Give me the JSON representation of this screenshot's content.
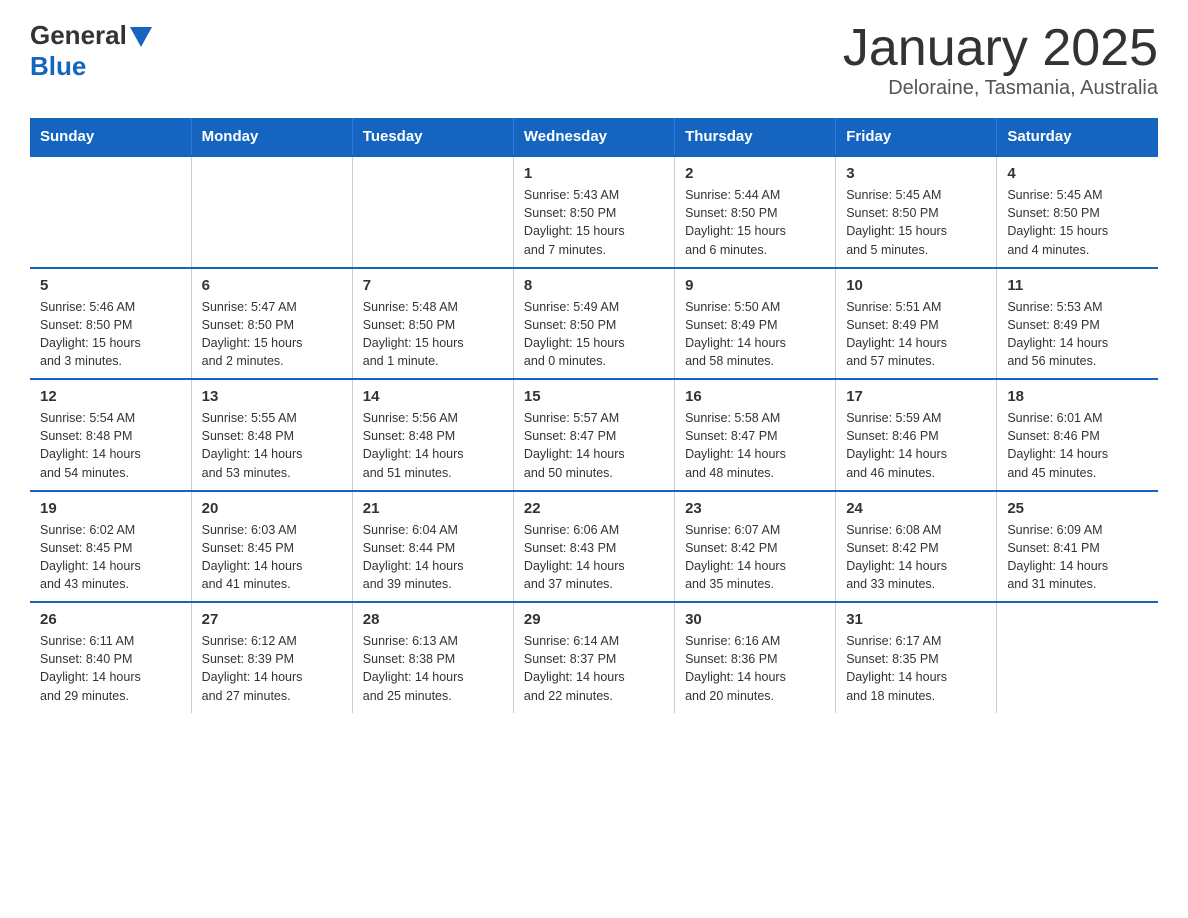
{
  "header": {
    "logo_general": "General",
    "logo_blue": "Blue",
    "title": "January 2025",
    "subtitle": "Deloraine, Tasmania, Australia"
  },
  "calendar": {
    "days_of_week": [
      "Sunday",
      "Monday",
      "Tuesday",
      "Wednesday",
      "Thursday",
      "Friday",
      "Saturday"
    ],
    "weeks": [
      [
        {
          "day": "",
          "info": ""
        },
        {
          "day": "",
          "info": ""
        },
        {
          "day": "",
          "info": ""
        },
        {
          "day": "1",
          "info": "Sunrise: 5:43 AM\nSunset: 8:50 PM\nDaylight: 15 hours\nand 7 minutes."
        },
        {
          "day": "2",
          "info": "Sunrise: 5:44 AM\nSunset: 8:50 PM\nDaylight: 15 hours\nand 6 minutes."
        },
        {
          "day": "3",
          "info": "Sunrise: 5:45 AM\nSunset: 8:50 PM\nDaylight: 15 hours\nand 5 minutes."
        },
        {
          "day": "4",
          "info": "Sunrise: 5:45 AM\nSunset: 8:50 PM\nDaylight: 15 hours\nand 4 minutes."
        }
      ],
      [
        {
          "day": "5",
          "info": "Sunrise: 5:46 AM\nSunset: 8:50 PM\nDaylight: 15 hours\nand 3 minutes."
        },
        {
          "day": "6",
          "info": "Sunrise: 5:47 AM\nSunset: 8:50 PM\nDaylight: 15 hours\nand 2 minutes."
        },
        {
          "day": "7",
          "info": "Sunrise: 5:48 AM\nSunset: 8:50 PM\nDaylight: 15 hours\nand 1 minute."
        },
        {
          "day": "8",
          "info": "Sunrise: 5:49 AM\nSunset: 8:50 PM\nDaylight: 15 hours\nand 0 minutes."
        },
        {
          "day": "9",
          "info": "Sunrise: 5:50 AM\nSunset: 8:49 PM\nDaylight: 14 hours\nand 58 minutes."
        },
        {
          "day": "10",
          "info": "Sunrise: 5:51 AM\nSunset: 8:49 PM\nDaylight: 14 hours\nand 57 minutes."
        },
        {
          "day": "11",
          "info": "Sunrise: 5:53 AM\nSunset: 8:49 PM\nDaylight: 14 hours\nand 56 minutes."
        }
      ],
      [
        {
          "day": "12",
          "info": "Sunrise: 5:54 AM\nSunset: 8:48 PM\nDaylight: 14 hours\nand 54 minutes."
        },
        {
          "day": "13",
          "info": "Sunrise: 5:55 AM\nSunset: 8:48 PM\nDaylight: 14 hours\nand 53 minutes."
        },
        {
          "day": "14",
          "info": "Sunrise: 5:56 AM\nSunset: 8:48 PM\nDaylight: 14 hours\nand 51 minutes."
        },
        {
          "day": "15",
          "info": "Sunrise: 5:57 AM\nSunset: 8:47 PM\nDaylight: 14 hours\nand 50 minutes."
        },
        {
          "day": "16",
          "info": "Sunrise: 5:58 AM\nSunset: 8:47 PM\nDaylight: 14 hours\nand 48 minutes."
        },
        {
          "day": "17",
          "info": "Sunrise: 5:59 AM\nSunset: 8:46 PM\nDaylight: 14 hours\nand 46 minutes."
        },
        {
          "day": "18",
          "info": "Sunrise: 6:01 AM\nSunset: 8:46 PM\nDaylight: 14 hours\nand 45 minutes."
        }
      ],
      [
        {
          "day": "19",
          "info": "Sunrise: 6:02 AM\nSunset: 8:45 PM\nDaylight: 14 hours\nand 43 minutes."
        },
        {
          "day": "20",
          "info": "Sunrise: 6:03 AM\nSunset: 8:45 PM\nDaylight: 14 hours\nand 41 minutes."
        },
        {
          "day": "21",
          "info": "Sunrise: 6:04 AM\nSunset: 8:44 PM\nDaylight: 14 hours\nand 39 minutes."
        },
        {
          "day": "22",
          "info": "Sunrise: 6:06 AM\nSunset: 8:43 PM\nDaylight: 14 hours\nand 37 minutes."
        },
        {
          "day": "23",
          "info": "Sunrise: 6:07 AM\nSunset: 8:42 PM\nDaylight: 14 hours\nand 35 minutes."
        },
        {
          "day": "24",
          "info": "Sunrise: 6:08 AM\nSunset: 8:42 PM\nDaylight: 14 hours\nand 33 minutes."
        },
        {
          "day": "25",
          "info": "Sunrise: 6:09 AM\nSunset: 8:41 PM\nDaylight: 14 hours\nand 31 minutes."
        }
      ],
      [
        {
          "day": "26",
          "info": "Sunrise: 6:11 AM\nSunset: 8:40 PM\nDaylight: 14 hours\nand 29 minutes."
        },
        {
          "day": "27",
          "info": "Sunrise: 6:12 AM\nSunset: 8:39 PM\nDaylight: 14 hours\nand 27 minutes."
        },
        {
          "day": "28",
          "info": "Sunrise: 6:13 AM\nSunset: 8:38 PM\nDaylight: 14 hours\nand 25 minutes."
        },
        {
          "day": "29",
          "info": "Sunrise: 6:14 AM\nSunset: 8:37 PM\nDaylight: 14 hours\nand 22 minutes."
        },
        {
          "day": "30",
          "info": "Sunrise: 6:16 AM\nSunset: 8:36 PM\nDaylight: 14 hours\nand 20 minutes."
        },
        {
          "day": "31",
          "info": "Sunrise: 6:17 AM\nSunset: 8:35 PM\nDaylight: 14 hours\nand 18 minutes."
        },
        {
          "day": "",
          "info": ""
        }
      ]
    ]
  }
}
